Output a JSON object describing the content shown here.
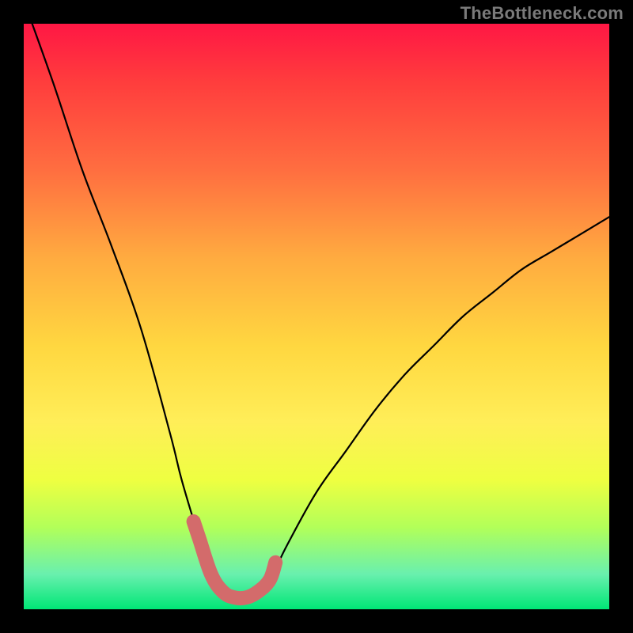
{
  "watermark": "TheBottleneck.com",
  "chart_data": {
    "type": "line",
    "title": "",
    "xlabel": "",
    "ylabel": "",
    "xlim": [
      0,
      100
    ],
    "ylim": [
      0,
      100
    ],
    "series": [
      {
        "name": "bottleneck-curve",
        "x": [
          0,
          5,
          10,
          15,
          20,
          25,
          27,
          30,
          32,
          34,
          36,
          38,
          40,
          42,
          45,
          50,
          55,
          60,
          65,
          70,
          75,
          80,
          85,
          90,
          95,
          100
        ],
        "values": [
          104,
          90,
          75,
          62,
          48,
          30,
          22,
          12,
          6,
          3,
          2,
          2,
          3,
          5,
          11,
          20,
          27,
          34,
          40,
          45,
          50,
          54,
          58,
          61,
          64,
          67
        ]
      },
      {
        "name": "highlight-band",
        "x": [
          29,
          30,
          32,
          34,
          36,
          38,
          40,
          42,
          43
        ],
        "values": [
          15,
          12,
          6,
          3,
          2,
          2,
          3,
          5,
          8
        ]
      }
    ],
    "colors": {
      "curve": "#000000",
      "highlight": "#d36b6b"
    }
  }
}
